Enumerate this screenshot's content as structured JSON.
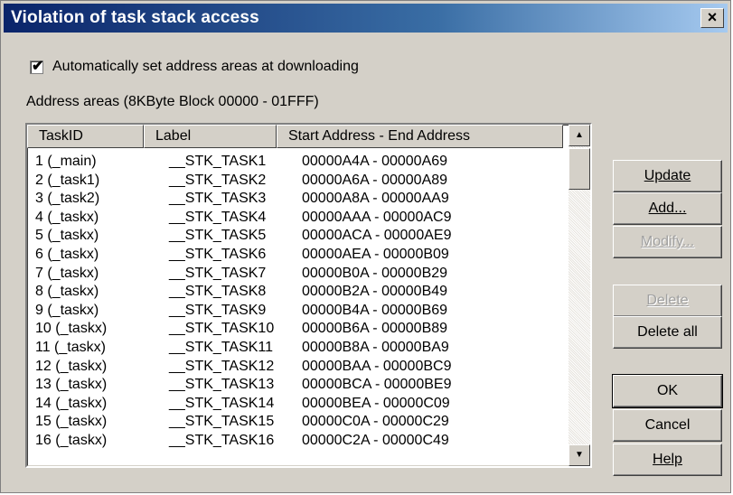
{
  "window": {
    "title": "Violation of task stack access",
    "close_label": "×"
  },
  "auto_set": {
    "checked": true,
    "check_mark": "✔",
    "label": "Automatically set address areas at downloading"
  },
  "group_label": "Address areas (8KByte Block  00000 - 01FFF)",
  "list": {
    "columns": [
      "TaskID",
      "Label",
      "Start Address - End Address"
    ],
    "rows": [
      [
        "1 (_main)",
        "__STK_TASK1",
        "00000A4A - 00000A69"
      ],
      [
        "2 (_task1)",
        "__STK_TASK2",
        "00000A6A - 00000A89"
      ],
      [
        "3 (_task2)",
        "__STK_TASK3",
        "00000A8A - 00000AA9"
      ],
      [
        "4 (_taskx)",
        "__STK_TASK4",
        "00000AAA - 00000AC9"
      ],
      [
        "5 (_taskx)",
        "__STK_TASK5",
        "00000ACA - 00000AE9"
      ],
      [
        "6 (_taskx)",
        "__STK_TASK6",
        "00000AEA - 00000B09"
      ],
      [
        "7 (_taskx)",
        "__STK_TASK7",
        "00000B0A - 00000B29"
      ],
      [
        "8 (_taskx)",
        "__STK_TASK8",
        "00000B2A - 00000B49"
      ],
      [
        "9 (_taskx)",
        "__STK_TASK9",
        "00000B4A - 00000B69"
      ],
      [
        "10 (_taskx)",
        "__STK_TASK10",
        "00000B6A - 00000B89"
      ],
      [
        "11 (_taskx)",
        "__STK_TASK11",
        "00000B8A - 00000BA9"
      ],
      [
        "12 (_taskx)",
        "__STK_TASK12",
        "00000BAA - 00000BC9"
      ],
      [
        "13 (_taskx)",
        "__STK_TASK13",
        "00000BCA - 00000BE9"
      ],
      [
        "14 (_taskx)",
        "__STK_TASK14",
        "00000BEA - 00000C09"
      ],
      [
        "15 (_taskx)",
        "__STK_TASK15",
        "00000C0A - 00000C29"
      ],
      [
        "16 (_taskx)",
        "__STK_TASK16",
        "00000C2A - 00000C49"
      ]
    ],
    "scroll_up_glyph": "▲",
    "scroll_down_glyph": "▼"
  },
  "buttons": {
    "update": {
      "label": "Update",
      "enabled": true
    },
    "add": {
      "label": "Add...",
      "enabled": true
    },
    "modify": {
      "label": "Modify...",
      "enabled": false
    },
    "delete": {
      "label": "Delete",
      "enabled": false
    },
    "delete_all": {
      "label": "Delete all",
      "enabled": true
    },
    "ok": {
      "label": "OK",
      "enabled": true
    },
    "cancel": {
      "label": "Cancel",
      "enabled": true
    },
    "help": {
      "label": "Help",
      "enabled": true
    }
  },
  "colors": {
    "title_start": "#0a246a",
    "title_end": "#a6caf0",
    "face": "#d4d0c8",
    "disabled_text": "#a0a0a0"
  }
}
